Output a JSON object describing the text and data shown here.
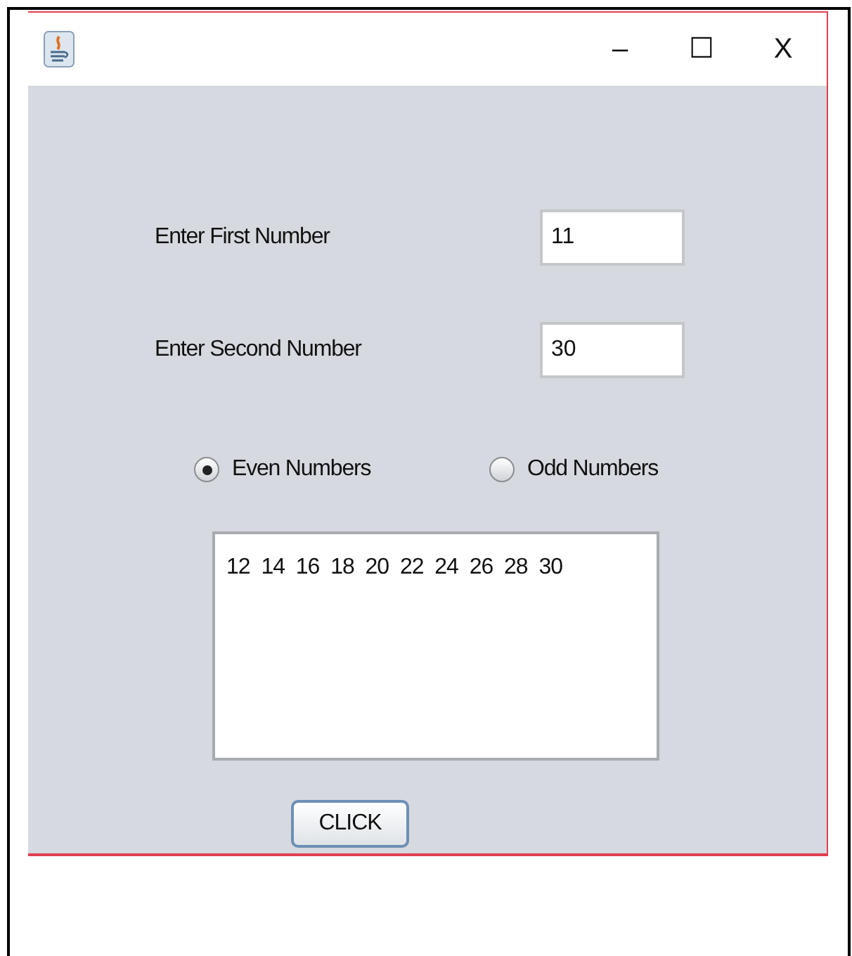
{
  "window": {
    "title_bar": {
      "buttons": [
        "–",
        "☐",
        "X"
      ]
    }
  },
  "fields": [
    {
      "label": "Enter First Number",
      "value": "11"
    },
    {
      "label": "Enter Second Number",
      "value": "30"
    }
  ],
  "radios": [
    {
      "label": "Even Numbers",
      "selected": true
    },
    {
      "label": "Odd Numbers",
      "selected": false
    }
  ],
  "output": {
    "text": "12  14  16  18  20  22  24  26  28  30"
  },
  "button": {
    "label": "CLICK"
  }
}
